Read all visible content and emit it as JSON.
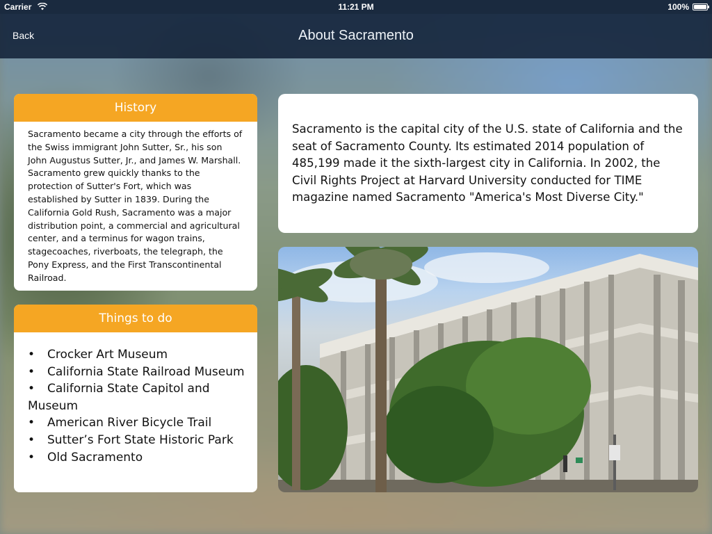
{
  "status_bar": {
    "carrier": "Carrier",
    "time": "11:21 PM",
    "battery": "100%"
  },
  "nav": {
    "back_label": "Back",
    "title": "About Sacramento"
  },
  "history": {
    "header": "History",
    "text": "Sacramento became a city through the efforts of the Swiss immigrant John Sutter, Sr., his son John Augustus Sutter, Jr., and James W. Marshall. Sacramento grew quickly thanks to the protection of Sutter's Fort, which was established by Sutter in 1839. During the California Gold Rush, Sacramento was a major distribution point, a commercial and agricultural center, and a terminus for wagon trains, stagecoaches, riverboats, the telegraph, the Pony Express, and the First Transcontinental Railroad."
  },
  "things_to_do": {
    "header": "Things to do",
    "bullet": "•",
    "items": [
      "Crocker Art Museum",
      "California State Railroad Museum",
      "California State Capitol and Museum",
      "American River Bicycle Trail",
      "Sutter’s Fort State Historic Park",
      "Old Sacramento"
    ]
  },
  "intro": {
    "text": "Sacramento is the capital city of the U.S. state of California and the seat of Sacramento County. Its estimated 2014 population of 485,199 made it the sixth-largest city in California. In 2002, the Civil Rights Project at Harvard University conducted for TIME magazine named Sacramento \"America's Most Diverse City.\""
  },
  "icons": {
    "wifi": "wifi-icon",
    "battery": "battery-icon"
  },
  "colors": {
    "accent": "#f5a623",
    "nav_background": "#10203a"
  }
}
